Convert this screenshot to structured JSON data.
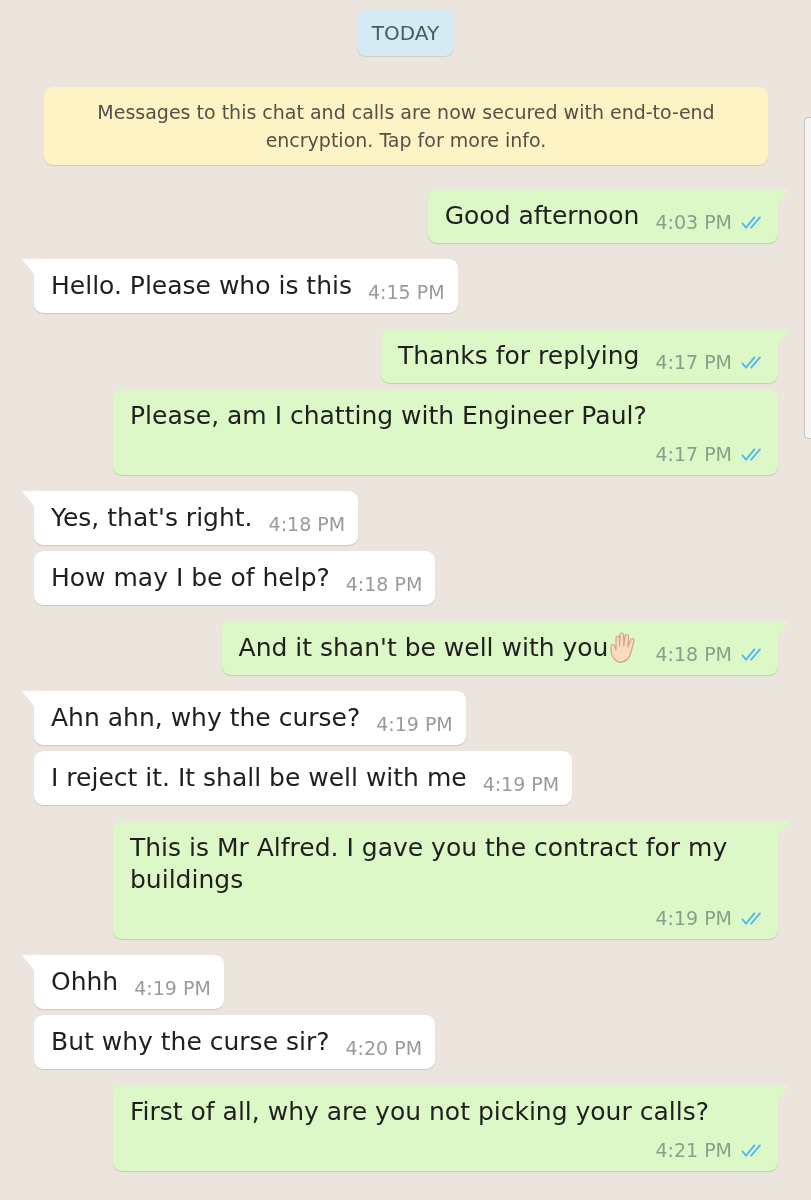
{
  "date_chip": {
    "label": "TODAY"
  },
  "encryption_notice": {
    "text": "Messages to this chat and calls are now secured with end-to-end encryption. Tap for more info."
  },
  "messages": [
    {
      "kind": "outgoing",
      "text": "Good afternoon",
      "time": "4:03 PM",
      "read": true,
      "emoji": false
    },
    {
      "kind": "incoming",
      "text": "Hello. Please who is this",
      "time": "4:15 PM",
      "emoji": false
    },
    {
      "kind": "outgoing",
      "text": "Thanks for replying",
      "time": "4:17 PM",
      "read": true,
      "emoji": false
    },
    {
      "kind": "outgoing",
      "text": "Please, am I chatting with Engineer Paul?",
      "time": "4:17 PM",
      "read": true,
      "emoji": false
    },
    {
      "kind": "incoming",
      "text": "Yes, that's right.",
      "time": "4:18 PM",
      "emoji": false
    },
    {
      "kind": "incoming",
      "text": "How may I be of help?",
      "time": "4:18 PM",
      "emoji": false
    },
    {
      "kind": "outgoing",
      "text": "And it shan't be well with you",
      "time": "4:18 PM",
      "read": true,
      "emoji": true
    },
    {
      "kind": "incoming",
      "text": "Ahn ahn, why the curse?",
      "time": "4:19 PM",
      "emoji": false
    },
    {
      "kind": "incoming",
      "text": "I reject it. It shall be well with me",
      "time": "4:19 PM",
      "emoji": false
    },
    {
      "kind": "outgoing",
      "text": "This is Mr Alfred. I gave you the contract for my buildings",
      "time": "4:19 PM",
      "read": true,
      "emoji": false
    },
    {
      "kind": "incoming",
      "text": "Ohhh",
      "time": "4:19 PM",
      "emoji": false
    },
    {
      "kind": "incoming",
      "text": "But why the curse sir?",
      "time": "4:20 PM",
      "emoji": false
    },
    {
      "kind": "outgoing",
      "text": "First of all, why are you not picking your calls?",
      "time": "4:21 PM",
      "read": true,
      "emoji": false
    }
  ]
}
